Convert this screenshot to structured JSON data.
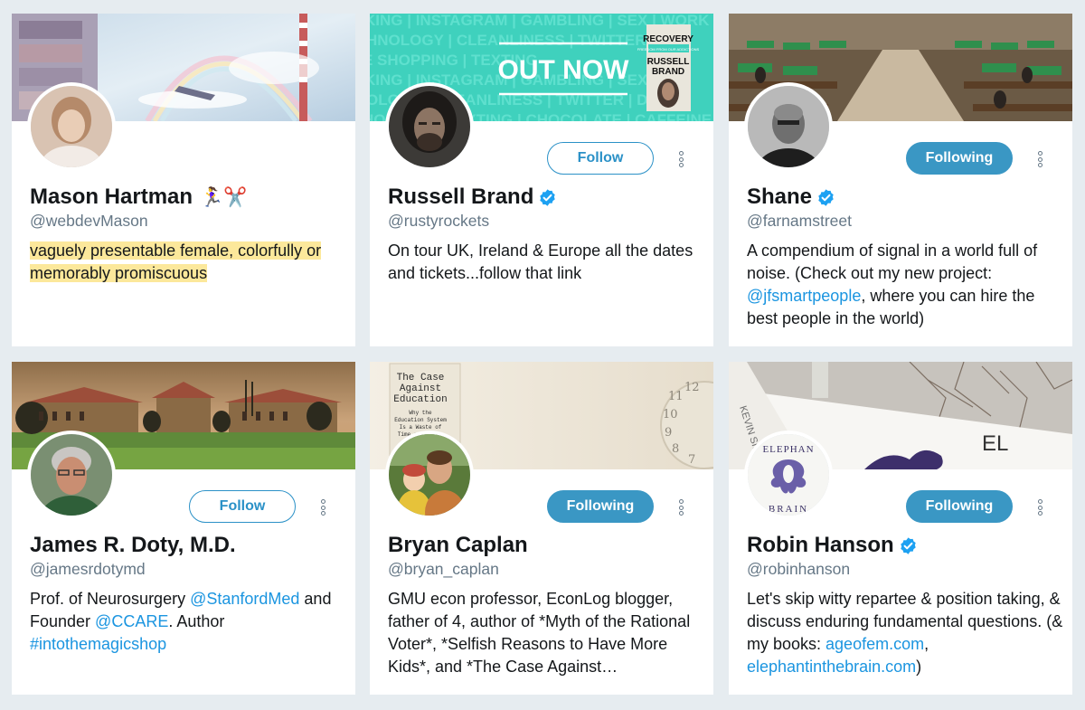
{
  "colors": {
    "page_bg": "#e6ecf0",
    "link": "#1b95e0",
    "follow_accent": "#2b91c7",
    "following_fill": "#3a97c4",
    "highlight": "#fce89b",
    "handle_gray": "#657786"
  },
  "cards": [
    {
      "name": "Mason Hartman",
      "emoji": "🏃‍♀️✂️",
      "handle": "@webdevMason",
      "bio_highlight": "vaguely presentable female, colorfully or memorably promiscuous"
    },
    {
      "name": "Russell Brand",
      "verified": true,
      "handle": "@rustyrockets",
      "button": "Follow",
      "bio": "On tour UK, Ireland & Europe all the dates and tickets...follow that link",
      "banner": {
        "out_now": "OUT NOW",
        "book_title": "RECOVERY",
        "book_subtitle": "FREEDOM FROM OUR ADDICTIONS",
        "book_author_1": "RUSSELL",
        "book_author_2": "BRAND",
        "bg_words_1": "KING | INSTAGRAM | GAMBLING | SEX | WORK | SH",
        "bg_words_2": "HNOLOGY | CLEANLINESS | TWITTER | F",
        "bg_words_3": "E SHOPPING | TEXTING",
        "bg_words_4": "KING | INSTAGRAM | GAMBLING | SEX",
        "bg_words_5": "OLOGY | CLEANLINESS | TWITTER | DRA",
        "bg_words_6": "HOPPING | TEXTING | CHOCOLATE | CAFFEINE"
      }
    },
    {
      "name": "Shane",
      "verified": true,
      "handle": "@farnamstreet",
      "button": "Following",
      "bio_1": "A compendium of signal in a world full of noise. (Check out my new project: ",
      "bio_link": "@jfsmartpeople",
      "bio_2": ", where you can hire the best people in the world)"
    },
    {
      "name": "James R. Doty, M.D.",
      "handle": "@jamesrdotymd",
      "button": "Follow",
      "bio_1": "Prof. of Neurosurgery ",
      "bio_link_1": "@StanfordMed",
      "bio_2": " and Founder ",
      "bio_link_2": "@CCARE",
      "bio_3": ". Author ",
      "bio_link_3": "#intothemagicshop"
    },
    {
      "name": "Bryan Caplan",
      "handle": "@bryan_caplan",
      "button": "Following",
      "bio": "GMU econ professor, EconLog blogger, father of 4, author of *Myth of the Rational Voter*, *Selfish Reasons to Have More Kids*, and *The Case Against…",
      "banner": {
        "book_line_1": "The Case",
        "book_line_2": "Against",
        "book_line_3": "Education",
        "book_line_4": "Why the",
        "book_line_5": "Education System",
        "book_line_6": "Is a Waste of",
        "book_line_7": "Time and Money"
      }
    },
    {
      "name": "Robin Hanson",
      "verified": true,
      "handle": "@robinhanson",
      "button": "Following",
      "bio_1": "Let's skip witty repartee & position taking, & discuss enduring fundamental questions. (& my books: ",
      "bio_link_1": "ageofem.com",
      "bio_2": ", ",
      "bio_link_2": "elephantinthebrain.com",
      "bio_3": ")",
      "banner": {
        "spine": "KEVIN SIM",
        "cover_letters": "EL"
      },
      "avatar": {
        "line_1": "ELEPHAN",
        "line_2": "BRAIN"
      }
    }
  ]
}
